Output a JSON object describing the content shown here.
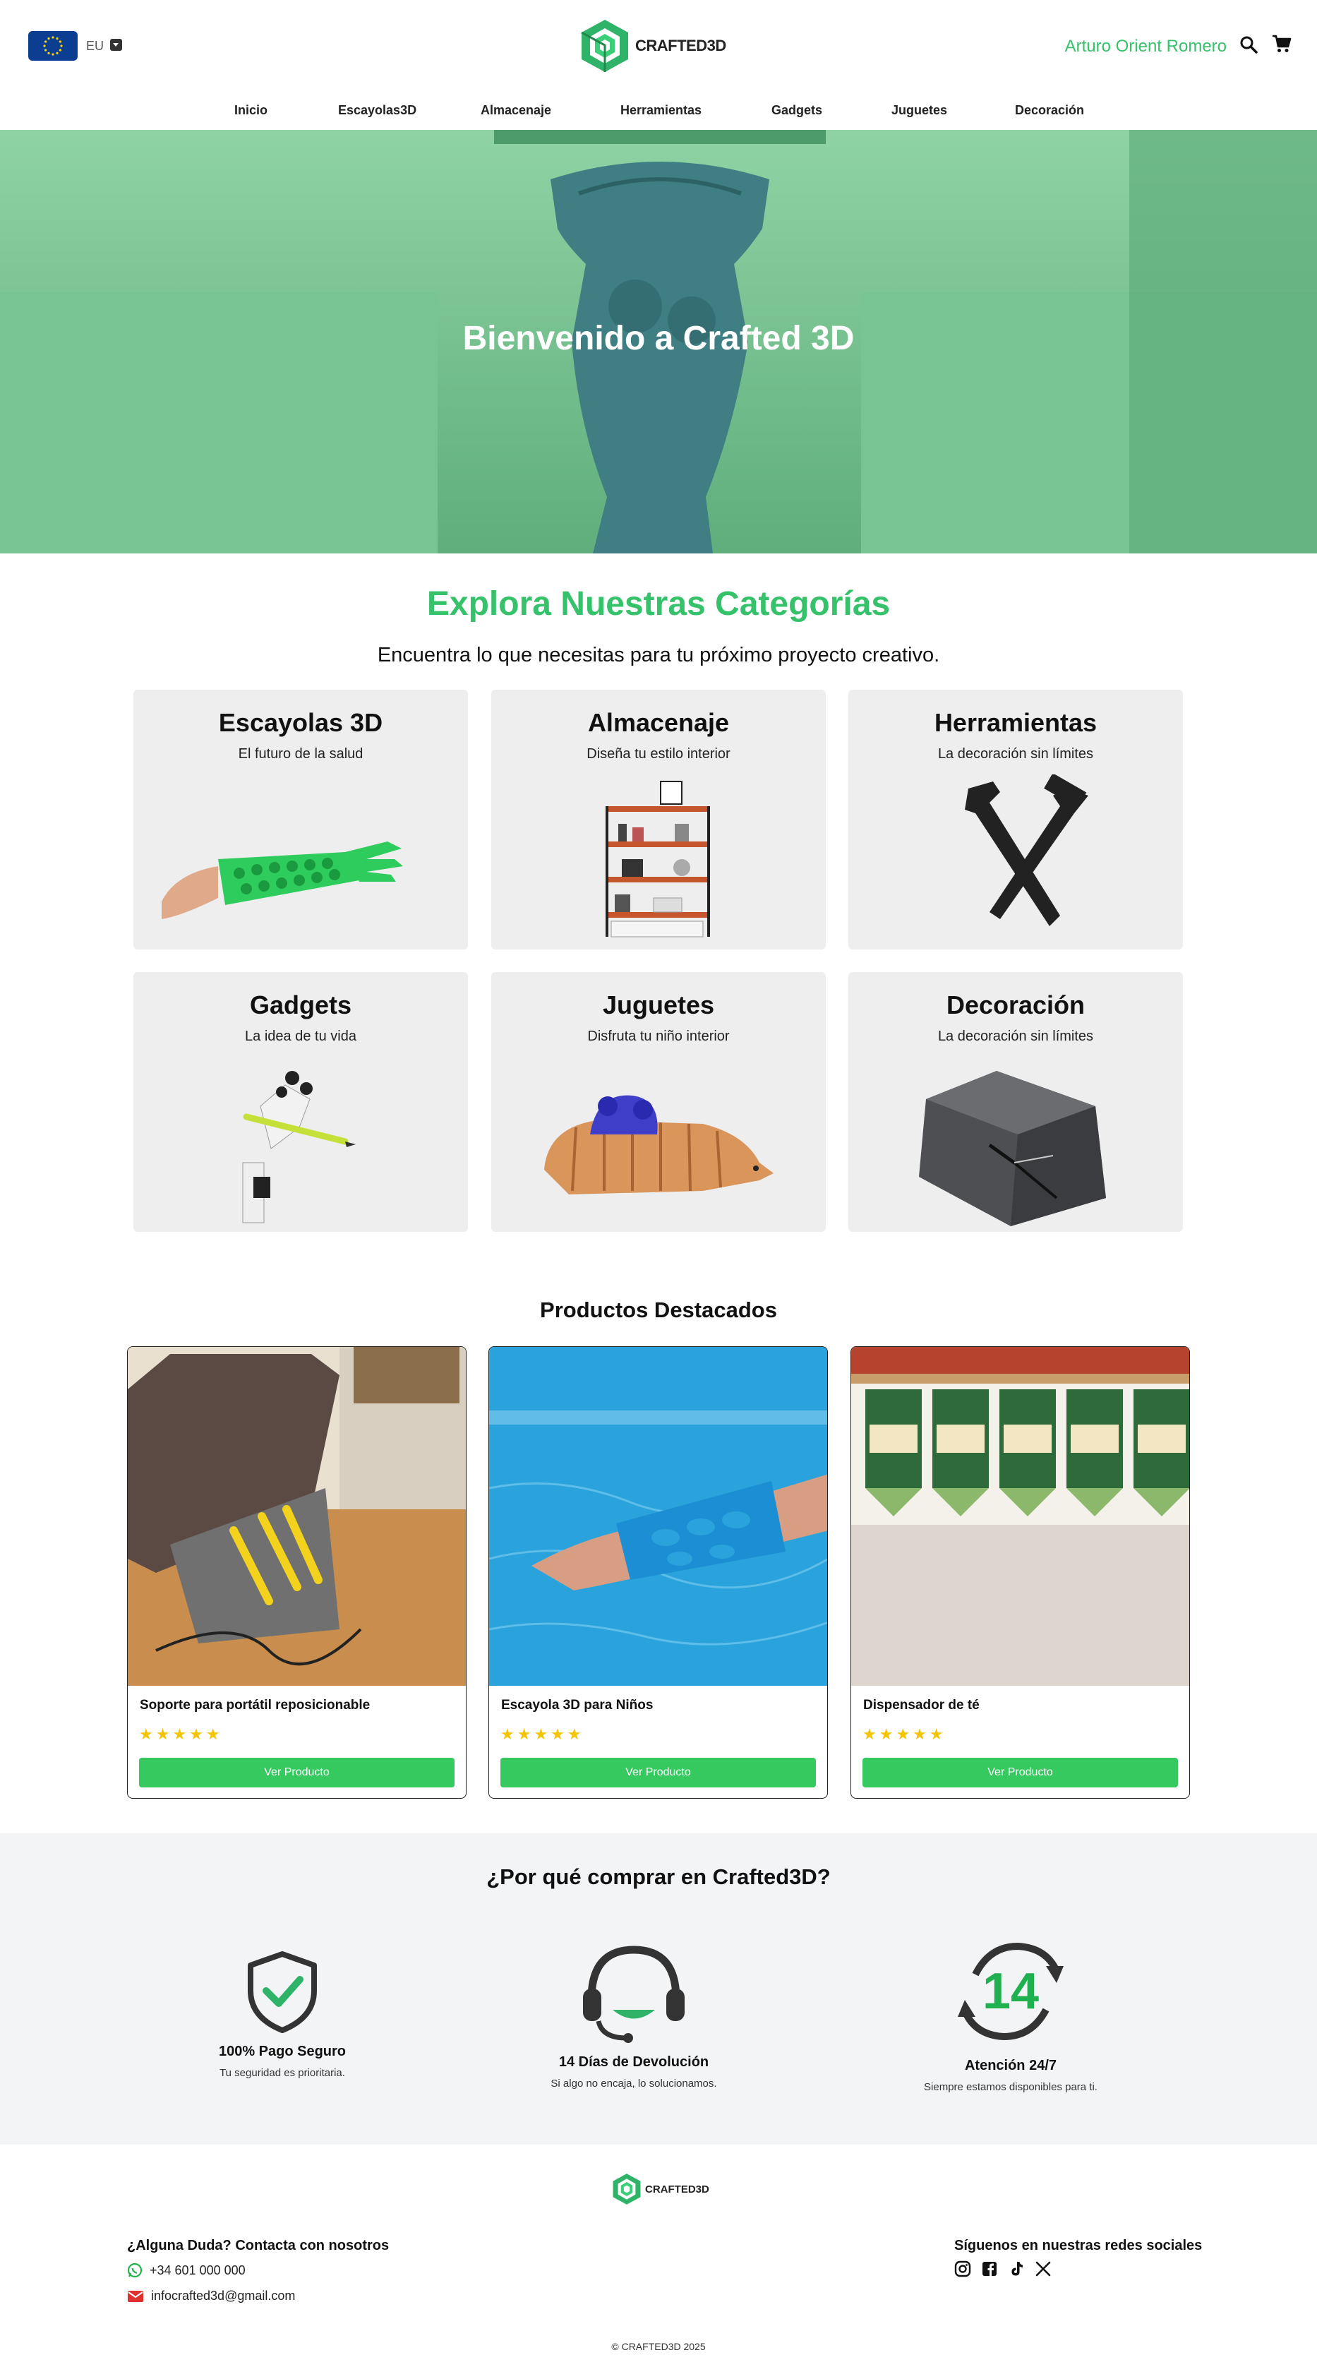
{
  "header": {
    "region": "EU",
    "logo_text": "CRAFTED3D",
    "user_name": "Arturo Orient Romero"
  },
  "nav": {
    "items": [
      "Inicio",
      "Escayolas3D",
      "Almacenaje",
      "Herramientas",
      "Gadgets",
      "Juguetes",
      "Decoración"
    ]
  },
  "hero": {
    "title": "Bienvenido a Crafted 3D"
  },
  "categories": {
    "title": "Explora Nuestras Categorías",
    "subtitle": "Encuentra lo que necesitas para tu próximo proyecto creativo.",
    "items": [
      {
        "name": "Escayolas 3D",
        "desc": "El futuro de la salud"
      },
      {
        "name": "Almacenaje",
        "desc": "Diseña tu estilo interior"
      },
      {
        "name": "Herramientas",
        "desc": "La decoración sin límites"
      },
      {
        "name": "Gadgets",
        "desc": "La idea de tu vida"
      },
      {
        "name": "Juguetes",
        "desc": "Disfruta tu niño interior"
      },
      {
        "name": "Decoración",
        "desc": "La decoración sin límites"
      }
    ]
  },
  "featured": {
    "title": "Productos Destacados",
    "products": [
      {
        "name": "Soporte para portátil reposicionable",
        "rating": 5,
        "stars": "★★★★★",
        "button": "Ver Producto"
      },
      {
        "name": "Escayola 3D para Niños",
        "rating": 5,
        "stars": "★★★★★",
        "button": "Ver Producto"
      },
      {
        "name": "Dispensador de té",
        "rating": 5,
        "stars": "★★★★★",
        "button": "Ver Producto"
      }
    ]
  },
  "why": {
    "title": "¿Por qué comprar en Crafted3D?",
    "items": [
      {
        "title": "100% Pago Seguro",
        "text": "Tu seguridad es prioritaria.",
        "icon": "shield-check-icon"
      },
      {
        "title": "14 Días de Devolución",
        "text": "Si algo no encaja, lo solucionamos.",
        "icon": "headset-icon"
      },
      {
        "title": "Atención 24/7",
        "text": "Siempre estamos disponibles para ti.",
        "icon": "return-14-icon",
        "badge": "14"
      }
    ]
  },
  "footer": {
    "logo_text": "CRAFTED3D",
    "contact_title": "¿Alguna Duda? Contacta con nosotros",
    "phone": "+34 601 000 000",
    "email": "infocrafted3d@gmail.com",
    "social_title": "Síguenos en nuestras redes sociales",
    "social": [
      "instagram-icon",
      "facebook-icon",
      "tiktok-icon",
      "x-icon"
    ],
    "copyright": "© CRAFTED3D 2025"
  },
  "colors": {
    "brand_green": "#36c26a",
    "button_green": "#36c95f",
    "star_yellow": "#f5c400",
    "hero_overlay": "#6fbf8a"
  }
}
